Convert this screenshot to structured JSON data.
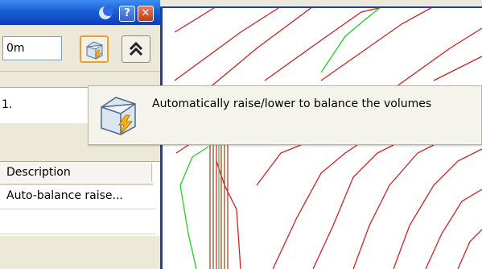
{
  "panel": {
    "title_buttons": {
      "help_label": "?",
      "close_label": "✕"
    },
    "value_input": "0m",
    "balance_button_icon": "auto-balance-icon",
    "raise_button_icon": "double-chevron-up-icon",
    "group_text": "1.",
    "table": {
      "header": "Description",
      "rows": [
        "Auto-balance raise..."
      ]
    }
  },
  "tooltip": {
    "icon": "auto-balance-icon",
    "text": "Automatically raise/lower to balance the volumes"
  },
  "colors": {
    "contour_red": "#d42020",
    "contour_green": "#20d020",
    "frame_blue": "#1c3fa8"
  }
}
